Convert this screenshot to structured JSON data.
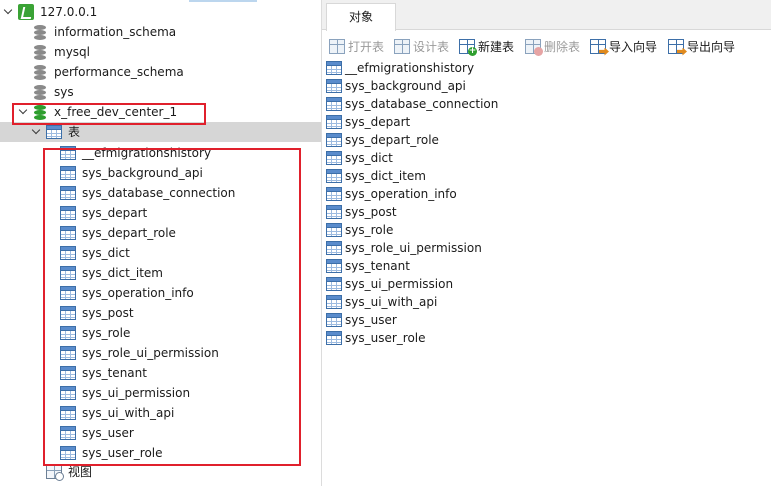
{
  "tree": {
    "connection": "127.0.0.1",
    "databases": [
      "information_schema",
      "mysql",
      "performance_schema",
      "sys"
    ],
    "open_database": "x_free_dev_center_1",
    "tables_folder": "表",
    "views_folder": "视图",
    "tables": [
      "__efmigrationshistory",
      "sys_background_api",
      "sys_database_connection",
      "sys_depart",
      "sys_depart_role",
      "sys_dict",
      "sys_dict_item",
      "sys_operation_info",
      "sys_post",
      "sys_role",
      "sys_role_ui_permission",
      "sys_tenant",
      "sys_ui_permission",
      "sys_ui_with_api",
      "sys_user",
      "sys_user_role"
    ]
  },
  "right_pane": {
    "tab": "对象",
    "toolbar": {
      "open_table": "打开表",
      "design_table": "设计表",
      "new_table": "新建表",
      "delete_table": "删除表",
      "import_wizard": "导入向导",
      "export_wizard": "导出向导"
    },
    "objects": [
      "__efmigrationshistory",
      "sys_background_api",
      "sys_database_connection",
      "sys_depart",
      "sys_depart_role",
      "sys_dict",
      "sys_dict_item",
      "sys_operation_info",
      "sys_post",
      "sys_role",
      "sys_role_ui_permission",
      "sys_tenant",
      "sys_ui_permission",
      "sys_ui_with_api",
      "sys_user",
      "sys_user_role"
    ]
  },
  "colors": {
    "highlight_box": "#e0202c",
    "selected_row": "#d6d6d6",
    "database_open": "#2e9e2e",
    "connection": "#3aa335"
  },
  "icons": {
    "connection": "connection-icon",
    "database": "database-icon",
    "table": "table-icon",
    "view": "view-icon"
  }
}
